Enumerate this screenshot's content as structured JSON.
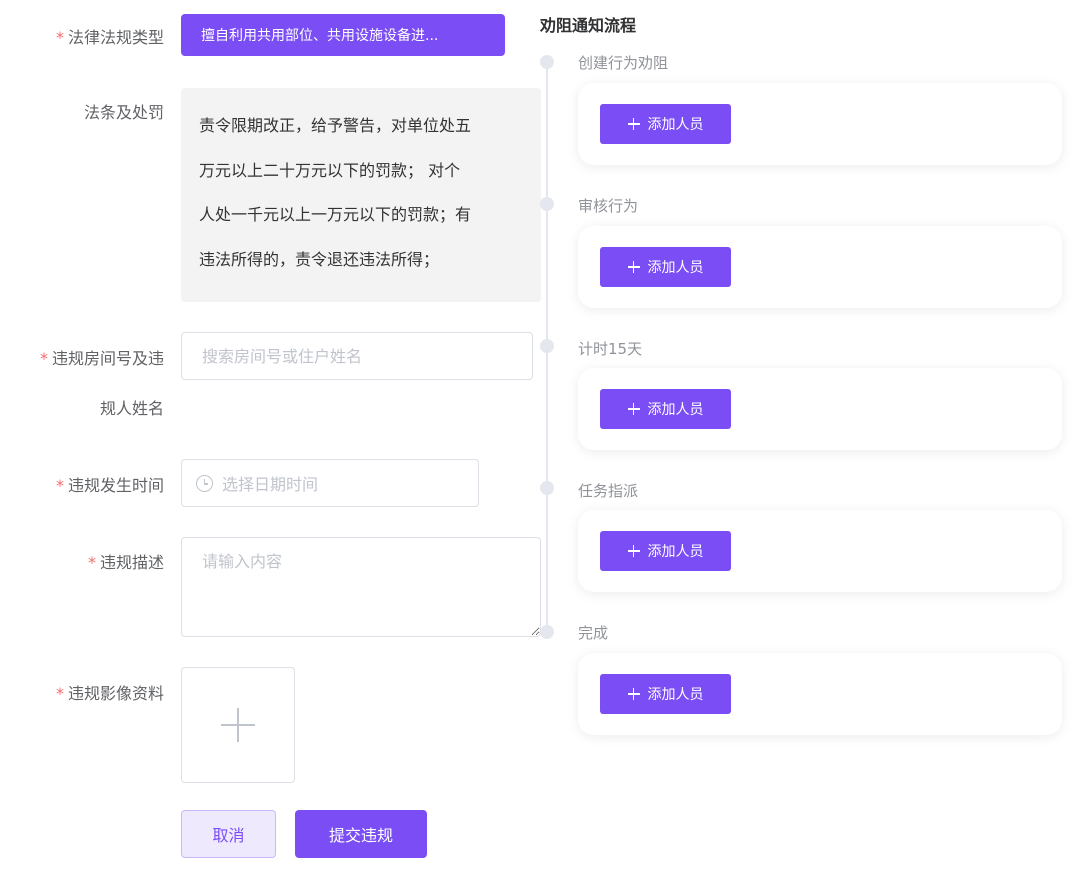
{
  "form": {
    "law_type": {
      "label": "法律法规类型",
      "value": "擅自利用共用部位、共用设施设备进..."
    },
    "penalty": {
      "label": "法条及处罚",
      "lines": [
        "责令限期改正，给予警告，对单位处五",
        "万元以上二十万元以下的罚款； 对个",
        "人处一千元以上一万元以下的罚款；有",
        "违法所得的，责令退还违法所得；"
      ]
    },
    "room": {
      "label_line1": "违规房间号及违",
      "label_line2": "规人姓名",
      "placeholder": "搜索房间号或住户姓名"
    },
    "time": {
      "label": "违规发生时间",
      "placeholder": "选择日期时间"
    },
    "description": {
      "label": "违规描述",
      "placeholder": "请输入内容"
    },
    "media": {
      "label": "违规影像资料"
    },
    "required_mark": "*",
    "buttons": {
      "cancel": "取消",
      "submit": "提交违规"
    }
  },
  "flow": {
    "title": "劝阻通知流程",
    "add_label": "添加人员",
    "steps": [
      {
        "label": "创建行为劝阻"
      },
      {
        "label": "审核行为"
      },
      {
        "label": "计时15天"
      },
      {
        "label": "任务指派"
      },
      {
        "label": "完成"
      }
    ]
  },
  "colors": {
    "primary": "#7b4ef5",
    "required": "#f56c6c",
    "panel": "#f3f3f3"
  },
  "icons": {
    "time": "clock-icon",
    "upload": "plus-icon",
    "add": "plus-icon"
  }
}
